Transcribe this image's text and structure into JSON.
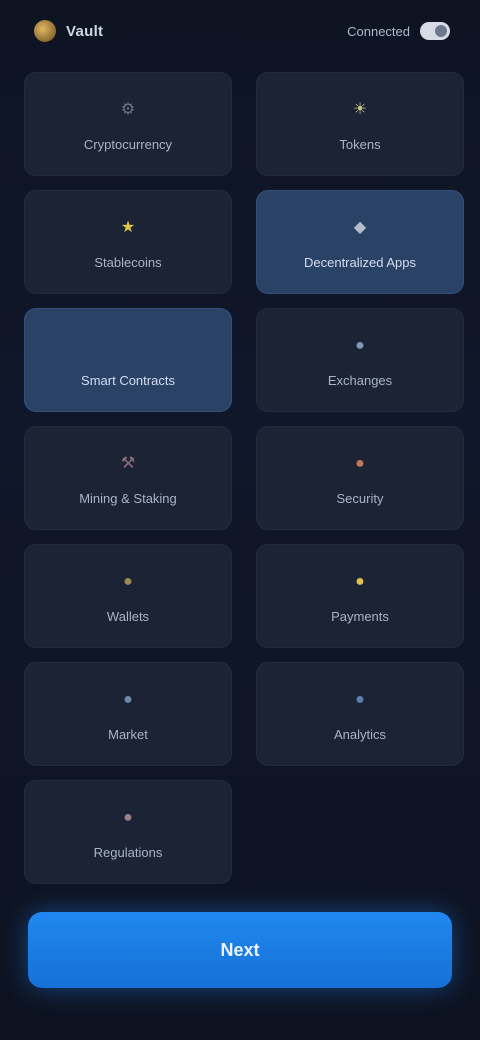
{
  "header": {
    "app_name": "Vault",
    "status_label": "Connected",
    "logo_icon": "coin-logo"
  },
  "tiles": [
    {
      "label": "Cryptocurrency",
      "icon": "gear-icon",
      "glyph": "⚙",
      "color": "#6b7486",
      "selected": false
    },
    {
      "label": "Tokens",
      "icon": "sun-icon",
      "glyph": "☀",
      "color": "#c9c48a",
      "selected": false
    },
    {
      "label": "Stablecoins",
      "icon": "star-icon",
      "glyph": "★",
      "color": "#e2c64a",
      "selected": false
    },
    {
      "label": "Decentralized Apps",
      "icon": "diamond-icon",
      "glyph": "◆",
      "color": "#b6bccb",
      "selected": true
    },
    {
      "label": "Smart Contracts",
      "icon": "blank-icon",
      "glyph": "",
      "color": "#2a4266",
      "selected": true
    },
    {
      "label": "Exchanges",
      "icon": "globe-icon",
      "glyph": "●",
      "color": "#7f9ab8",
      "selected": false
    },
    {
      "label": "Mining & Staking",
      "icon": "pickaxe-icon",
      "glyph": "⚒",
      "color": "#8c6f7a",
      "selected": false
    },
    {
      "label": "Security",
      "icon": "flame-icon",
      "glyph": "●",
      "color": "#c07858",
      "selected": false
    },
    {
      "label": "Wallets",
      "icon": "wallet-icon",
      "glyph": "●",
      "color": "#9c8a55",
      "selected": false
    },
    {
      "label": "Payments",
      "icon": "coin-icon",
      "glyph": "●",
      "color": "#e0c050",
      "selected": false
    },
    {
      "label": "Market",
      "icon": "chart-icon",
      "glyph": "●",
      "color": "#6d8aa8",
      "selected": false
    },
    {
      "label": "Analytics",
      "icon": "shield-icon",
      "glyph": "●",
      "color": "#5e7fb0",
      "selected": false
    },
    {
      "label": "Regulations",
      "icon": "scale-icon",
      "glyph": "●",
      "color": "#9a7f86",
      "selected": false
    }
  ],
  "cta": {
    "label": "Next"
  }
}
